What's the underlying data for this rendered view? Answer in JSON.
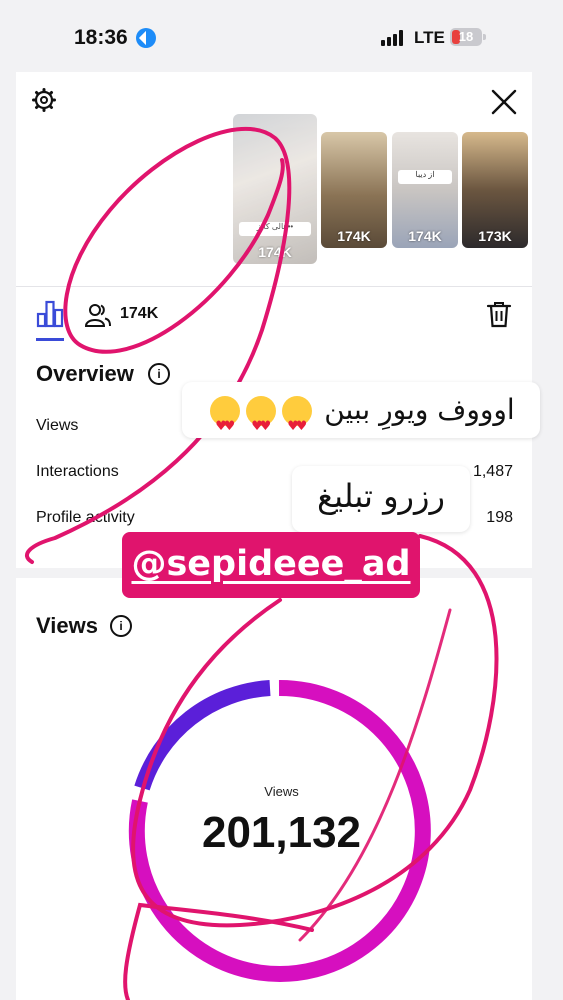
{
  "status_bar": {
    "time": "18:36",
    "network": "LTE",
    "battery": "18"
  },
  "header": {
    "settings_icon": "gear-icon",
    "close_icon": "close-icon",
    "thumbnails": [
      {
        "count": "174K",
        "caption": "هالی کایز••"
      },
      {
        "count": "174K",
        "caption": ""
      },
      {
        "count": "174K",
        "caption": "از دیبا"
      },
      {
        "count": "173K",
        "caption": ""
      }
    ]
  },
  "tabs": {
    "reach_count": "174K"
  },
  "overview": {
    "title": "Overview",
    "rows": [
      {
        "label": "Views",
        "value": ""
      },
      {
        "label": "Interactions",
        "value": "1,487"
      },
      {
        "label": "Profile activity",
        "value": "198"
      }
    ]
  },
  "views_section": {
    "title": "Views",
    "ring_label": "Views",
    "total": "201,132"
  },
  "stickers": {
    "text1": "اوووف ویورِ ببین",
    "text2": "رزرو تبلیغ",
    "mention": "@sepideee_ad"
  },
  "colors": {
    "accent_blue": "#3a4bd8",
    "ring_magenta": "#d60fbf",
    "ring_purple": "#5b1fd9",
    "scribble": "#e0146d"
  }
}
